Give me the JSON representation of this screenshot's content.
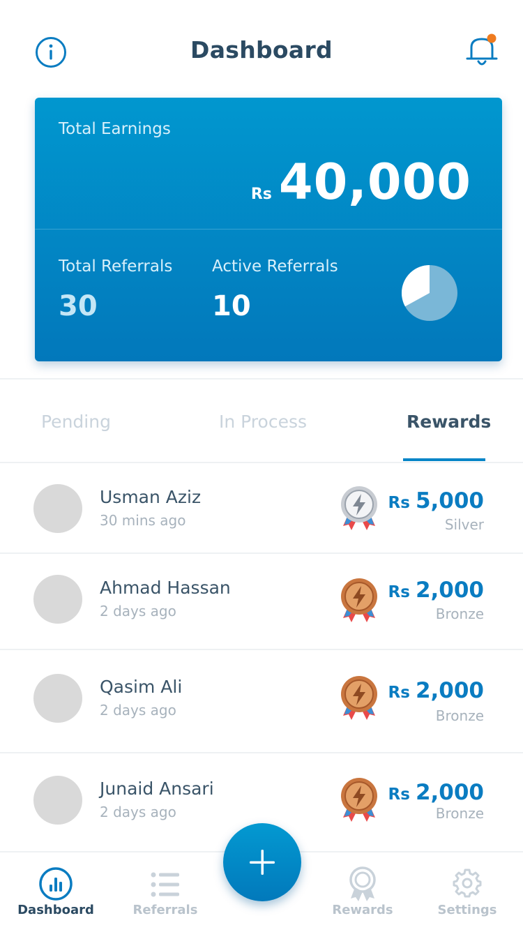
{
  "header": {
    "title": "Dashboard",
    "info_icon": "info-icon",
    "bell_icon": "bell-icon",
    "notification_dot_color": "#ef7b1f"
  },
  "summary": {
    "earnings_label": "Total Earnings",
    "currency": "Rs",
    "earnings_value": "40,000",
    "total_referrals_label": "Total Referrals",
    "total_referrals_value": "30",
    "active_referrals_label": "Active Referrals",
    "active_referrals_value": "10",
    "active_fraction": 0.33,
    "card_color": "#0288c6"
  },
  "tabs": [
    {
      "label": "Pending",
      "active": false
    },
    {
      "label": "In Process",
      "active": false
    },
    {
      "label": "Rewards",
      "active": true
    }
  ],
  "rewards": [
    {
      "name": "Usman Aziz",
      "time": "30 mins ago",
      "currency": "Rs",
      "amount": "5,000",
      "tier": "Silver",
      "medal_icon": "silver-medal-icon"
    },
    {
      "name": "Ahmad Hassan",
      "time": "2 days ago",
      "currency": "Rs",
      "amount": "2,000",
      "tier": "Bronze",
      "medal_icon": "bronze-medal-icon"
    },
    {
      "name": "Qasim Ali",
      "time": "2 days ago",
      "currency": "Rs",
      "amount": "2,000",
      "tier": "Bronze",
      "medal_icon": "bronze-medal-icon"
    },
    {
      "name": "Junaid Ansari",
      "time": "2 days ago",
      "currency": "Rs",
      "amount": "2,000",
      "tier": "Bronze",
      "medal_icon": "bronze-medal-icon"
    }
  ],
  "nav": {
    "items": [
      {
        "label": "Dashboard",
        "icon": "chart-icon",
        "active": true
      },
      {
        "label": "Referrals",
        "icon": "list-icon",
        "active": false
      },
      {
        "label": "Rewards",
        "icon": "award-icon",
        "active": false
      },
      {
        "label": "Settings",
        "icon": "gear-icon",
        "active": false
      }
    ],
    "fab_icon": "plus-icon"
  }
}
